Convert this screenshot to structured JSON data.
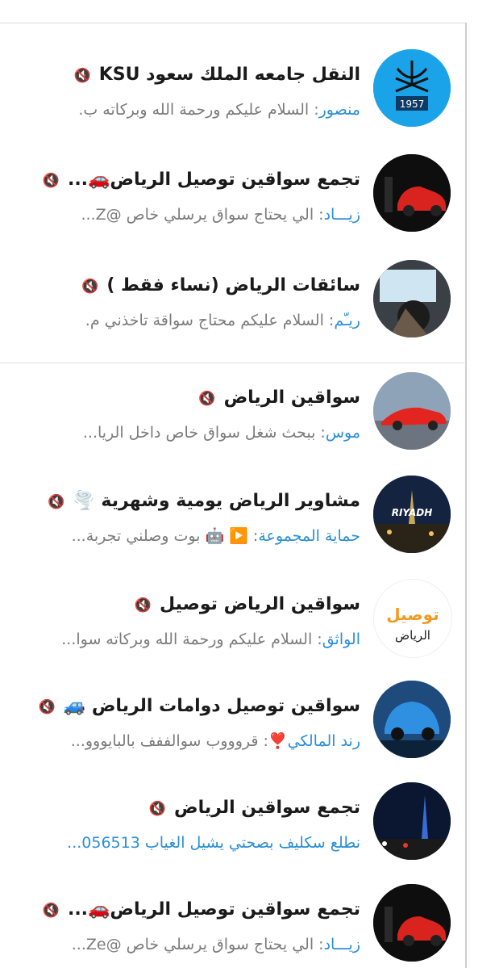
{
  "chats": [
    {
      "title": "النقل جامعه الملك سعود KSU",
      "title_emoji": "",
      "sender": "منصور",
      "preview": "السلام عليكم ورحمة الله وبركاته   ب.",
      "avatar_text": "1957"
    },
    {
      "title": "تجمع سواقين توصيل الرياض🚗...",
      "title_emoji": "",
      "sender": "زيـــاد",
      "preview": "الي يحتاج سواق يرسلي خاص @Z...",
      "avatar_text": ""
    },
    {
      "title": "سائقات الرياض (نساء فقط )",
      "title_emoji": "",
      "sender": "ريـّم",
      "preview": "السلام عليكم  محتاج سواقة تاخذني م.",
      "avatar_text": ""
    },
    {
      "title": "سواقين الرياض",
      "title_emoji": "",
      "sender": "موس",
      "preview": "ببحث شغل سواق خاص داخل الريا...",
      "avatar_text": ""
    },
    {
      "title": "مشاوير الرياض يومية وشهرية 🌪️",
      "title_emoji": "",
      "sender": "حماية المجموعة",
      "preview": "▶️ 🤖 بوت وصلني تجربة...",
      "avatar_text": "RIYADH"
    },
    {
      "title": "سواقين الرياض توصيل",
      "title_emoji": "",
      "sender": "الواثق",
      "preview": "السلام عليكم ورحمة الله وبركاته  سوا...",
      "avatar_text": "توصيل الرياض"
    },
    {
      "title": "سواقين توصيل دوامات الرياض 🚙",
      "title_emoji": "",
      "sender": "رند المالكي❣️",
      "preview": " قروووب سوالففف بالبايووو...",
      "avatar_text": ""
    },
    {
      "title": "تجمع سواقين الرياض",
      "title_emoji": "",
      "sender": "",
      "preview": "نطلع سكليف بصحتي يشيل الغياب 056513...",
      "avatar_text": ""
    },
    {
      "title": "تجمع سواقين توصيل الرياض🚗...",
      "title_emoji": "",
      "sender": "زيـــاد",
      "preview": "الي يحتاج سواق يرسلي خاص @Ze...",
      "avatar_text": ""
    }
  ],
  "icons": {
    "mute": "muted-bell-icon"
  },
  "colors": {
    "sender": "#2a8fd6",
    "title": "#1a1a1a",
    "preview": "#7b7b7b"
  }
}
